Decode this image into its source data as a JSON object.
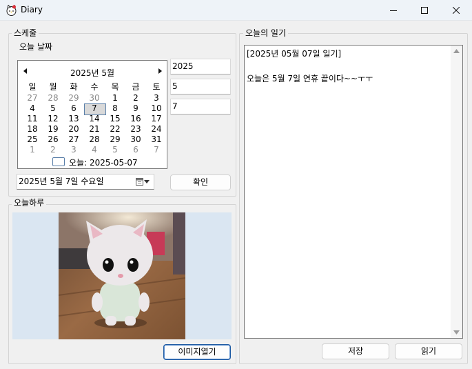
{
  "window": {
    "title": "Diary",
    "icon": "hello-kitty-icon"
  },
  "schedule": {
    "group_label": "스케줄",
    "today_label": "오늘 날짜",
    "calendar": {
      "month_title": "2025년 5월",
      "weekdays": [
        "일",
        "월",
        "화",
        "수",
        "목",
        "금",
        "토"
      ],
      "weeks": [
        [
          "27",
          "28",
          "29",
          "30",
          "1",
          "2",
          "3"
        ],
        [
          "4",
          "5",
          "6",
          "7",
          "8",
          "9",
          "10"
        ],
        [
          "11",
          "12",
          "13",
          "14",
          "15",
          "16",
          "17"
        ],
        [
          "18",
          "19",
          "20",
          "21",
          "22",
          "23",
          "24"
        ],
        [
          "25",
          "26",
          "27",
          "28",
          "29",
          "30",
          "31"
        ],
        [
          "1",
          "2",
          "3",
          "4",
          "5",
          "6",
          "7"
        ]
      ],
      "selected_day": "7",
      "today_text": "오늘: 2025-05-07"
    },
    "year_value": "2025",
    "month_value": "5",
    "day_value": "7",
    "date_picker_value": "2025년   5월   7일 수요일",
    "confirm_label": "확인"
  },
  "today_photo": {
    "group_label": "오늘하루",
    "open_image_label": "이미지열기"
  },
  "diary": {
    "group_label": "오늘의 일기",
    "text": "[2025년 05월 07일 일기]\n\n오늘은 5월 7일 연휴 끝이다~~ㅜㅜ",
    "save_label": "저장",
    "read_label": "읽기"
  },
  "colors": {
    "accent": "#1d5aa3",
    "photo_bg": "#dae6f2"
  }
}
